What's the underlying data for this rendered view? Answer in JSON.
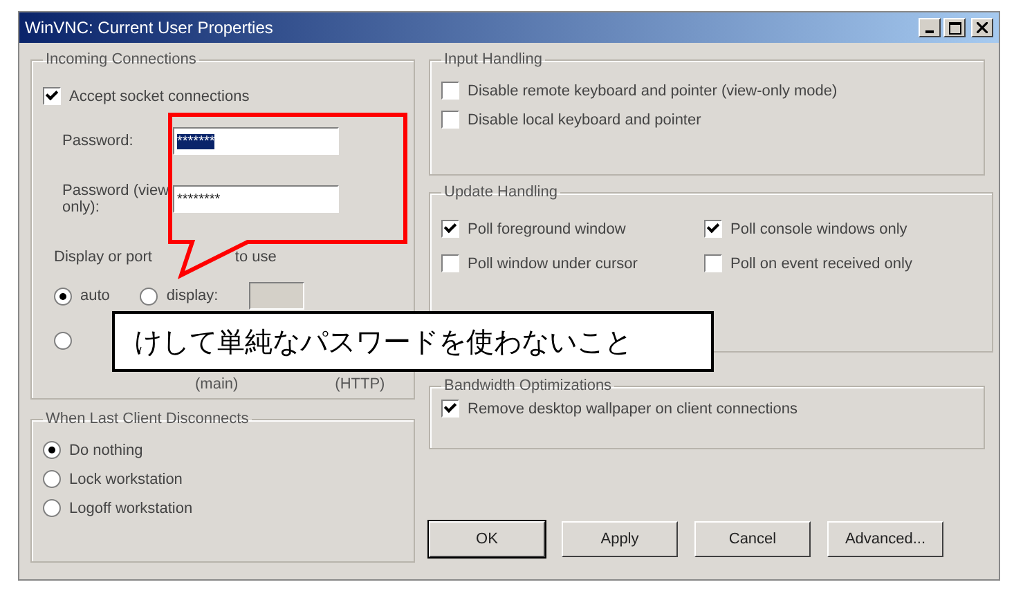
{
  "window": {
    "title": "WinVNC: Current User Properties"
  },
  "incoming": {
    "title": "Incoming Connections",
    "accept": {
      "label": "Accept socket connections",
      "checked": true
    },
    "password": {
      "label": "Password:",
      "value": "*******"
    },
    "password_view": {
      "label": "Password (view only):",
      "value": "********"
    },
    "display_label_parts": [
      "Display or port",
      "to use"
    ],
    "display_options": [
      {
        "label": "auto",
        "selected": true
      },
      {
        "label": "display:",
        "selected": false
      }
    ],
    "port_option": {
      "selected": false
    },
    "port_labels": [
      "(main)",
      "(HTTP)"
    ]
  },
  "disconnect": {
    "title": "When Last Client Disconnects",
    "options": [
      {
        "label": "Do nothing",
        "selected": true
      },
      {
        "label": "Lock workstation",
        "selected": false
      },
      {
        "label": "Logoff workstation",
        "selected": false
      }
    ]
  },
  "input_handling": {
    "title": "Input Handling",
    "options": [
      {
        "label": "Disable remote keyboard and pointer (view-only mode)",
        "checked": false
      },
      {
        "label": "Disable local keyboard and pointer",
        "checked": false
      }
    ]
  },
  "update_handling": {
    "title": "Update Handling",
    "options": [
      {
        "label": "Poll foreground window",
        "checked": true
      },
      {
        "label": "Poll console windows only",
        "checked": true
      },
      {
        "label": "Poll window under cursor",
        "checked": false
      },
      {
        "label": "Poll on event received only",
        "checked": false
      }
    ]
  },
  "bandwidth": {
    "title": "Bandwidth Optimizations",
    "options": [
      {
        "label": "Remove desktop wallpaper on client connections",
        "checked": true
      }
    ]
  },
  "buttons": [
    {
      "label": "OK",
      "default": true
    },
    {
      "label": "Apply",
      "default": false
    },
    {
      "label": "Cancel",
      "default": false
    },
    {
      "label": "Advanced...",
      "default": false
    }
  ],
  "note": {
    "text": "けして単純なパスワードを使わないこと"
  }
}
